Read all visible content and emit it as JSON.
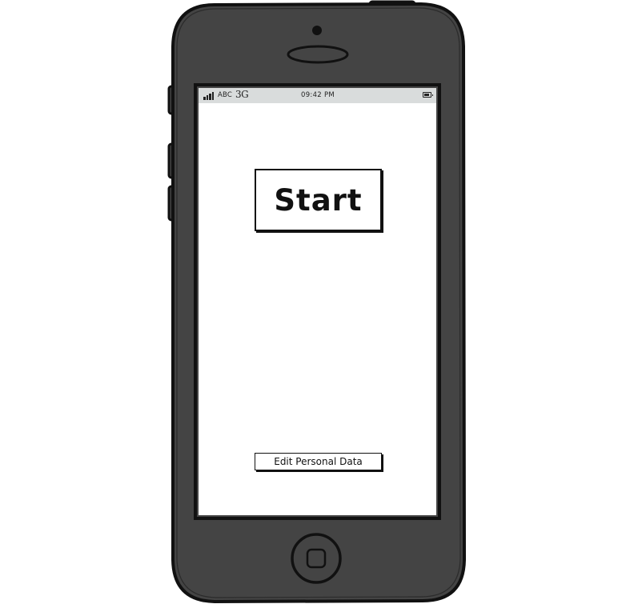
{
  "device": {
    "type": "smartphone",
    "body_color": "#444444",
    "outline_color": "#111111"
  },
  "status_bar": {
    "carrier": "ABC",
    "network": "3G",
    "time": "09:42 PM",
    "signal_icon": "signal-bars-icon",
    "battery_icon": "battery-icon"
  },
  "screen": {
    "start_button_label": "Start",
    "edit_button_label": "Edit Personal Data"
  }
}
